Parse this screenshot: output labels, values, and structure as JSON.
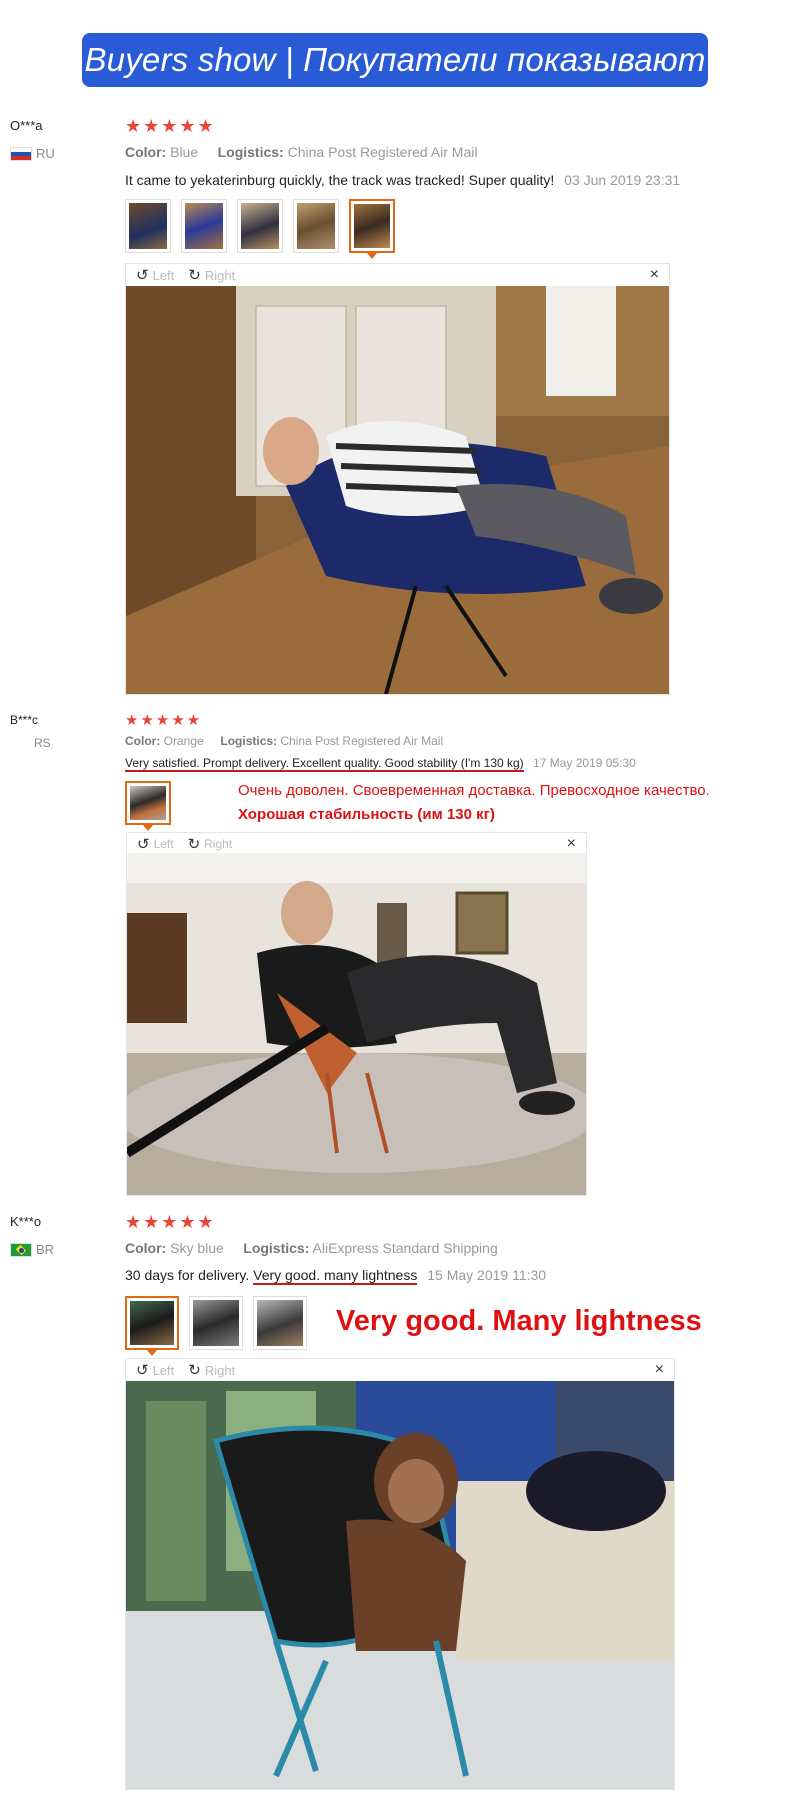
{
  "banner": {
    "title": "Buyers show | Покупатели показывают"
  },
  "reviews": [
    {
      "user": "O***a",
      "country": "RU",
      "stars": "★★★★★",
      "color_label": "Color:",
      "color_value": "Blue",
      "logistics_label": "Logistics:",
      "logistics_value": "China Post Registered Air Mail",
      "comment": "It came to yekaterinburg quickly, the track was tracked! Super quality!",
      "date": "03 Jun 2019 23:31",
      "viewer": {
        "left": "Left",
        "right": "Right",
        "close": "×"
      }
    },
    {
      "user": "B***c",
      "country": "RS",
      "stars": "★★★★★",
      "color_label": "Color:",
      "color_value": "Orange",
      "logistics_label": "Logistics:",
      "logistics_value": "China Post Registered Air Mail",
      "comment": "Very satisfied. Prompt delivery. Excellent quality. Good stability (I'm 130 kg)",
      "date": "17 May 2019 05:30",
      "translation_line1": "Очень доволен. Своевременная доставка. Превосходное качество.",
      "translation_line2": "Хорошая стабильность (им 130 кг)",
      "viewer": {
        "left": "Left",
        "right": "Right",
        "close": "×"
      }
    },
    {
      "user": "K***o",
      "country": "BR",
      "stars": "★★★★★",
      "color_label": "Color:",
      "color_value": "Sky blue",
      "logistics_label": "Logistics:",
      "logistics_value": "AliExpress Standard Shipping",
      "comment_prefix": "30 days for delivery. ",
      "comment_highlight": "Very good. many lightness",
      "date": "15 May 2019 11:30",
      "callout": "Very good. Many lightness",
      "viewer": {
        "left": "Left",
        "right": "Right",
        "close": "×"
      }
    }
  ]
}
